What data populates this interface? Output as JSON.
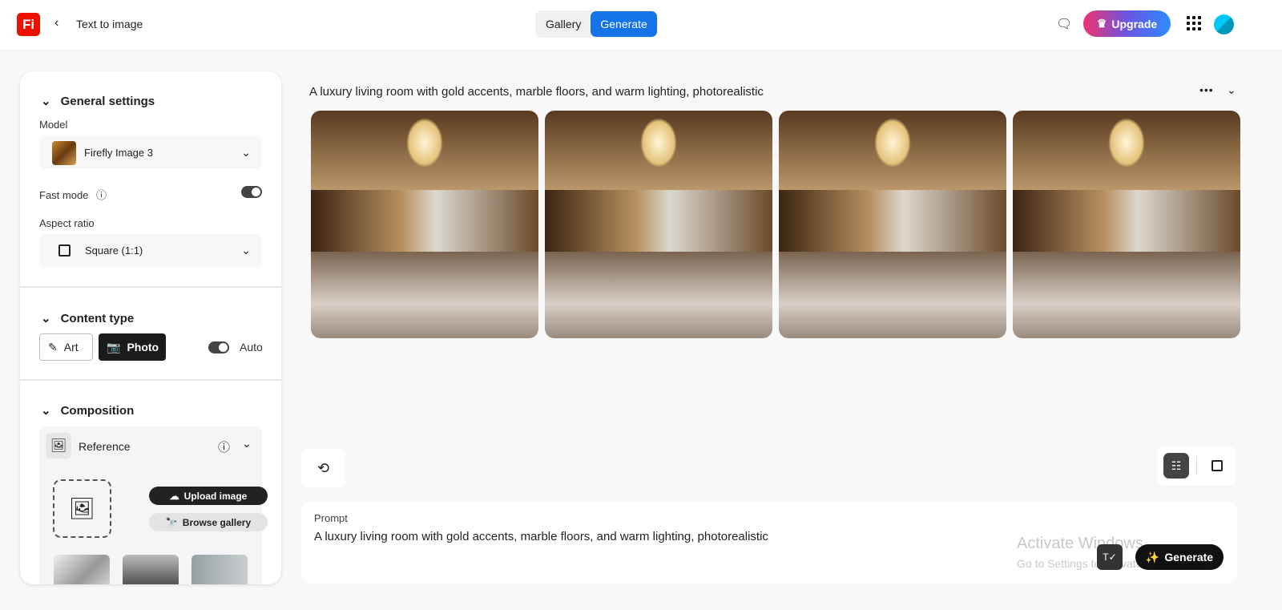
{
  "app": {
    "logo": "Fi",
    "breadcrumb": "Text to image"
  },
  "header": {
    "tabs": [
      {
        "label": "Gallery",
        "active": false
      },
      {
        "label": "Generate",
        "active": true
      }
    ],
    "upgrade": "Upgrade"
  },
  "colors": {
    "accent": "#1473e6",
    "logo": "#eb1000"
  },
  "sidebar": {
    "general": {
      "title": "General settings",
      "model_label": "Model",
      "model_value": "Firefly Image 3",
      "fast_mode_label": "Fast mode",
      "fast_mode_on": true,
      "aspect_label": "Aspect ratio",
      "aspect_value": "Square (1:1)"
    },
    "content_type": {
      "title": "Content type",
      "art": "Art",
      "photo": "Photo",
      "selected": "Photo",
      "auto_label": "Auto",
      "auto_on": true
    },
    "composition": {
      "title": "Composition",
      "reference": "Reference",
      "upload": "Upload image",
      "browse": "Browse gallery"
    }
  },
  "main": {
    "prompt_title": "A luxury living room with gold accents, marble floors, and warm lighting, photorealistic"
  },
  "prompt": {
    "label": "Prompt",
    "value": "A luxury living room with gold accents, marble floors, and warm lighting, photorealistic",
    "generate": "Generate"
  },
  "watermark": {
    "line1": "Activate Windows",
    "line2": "Go to Settings to activate Windows."
  }
}
